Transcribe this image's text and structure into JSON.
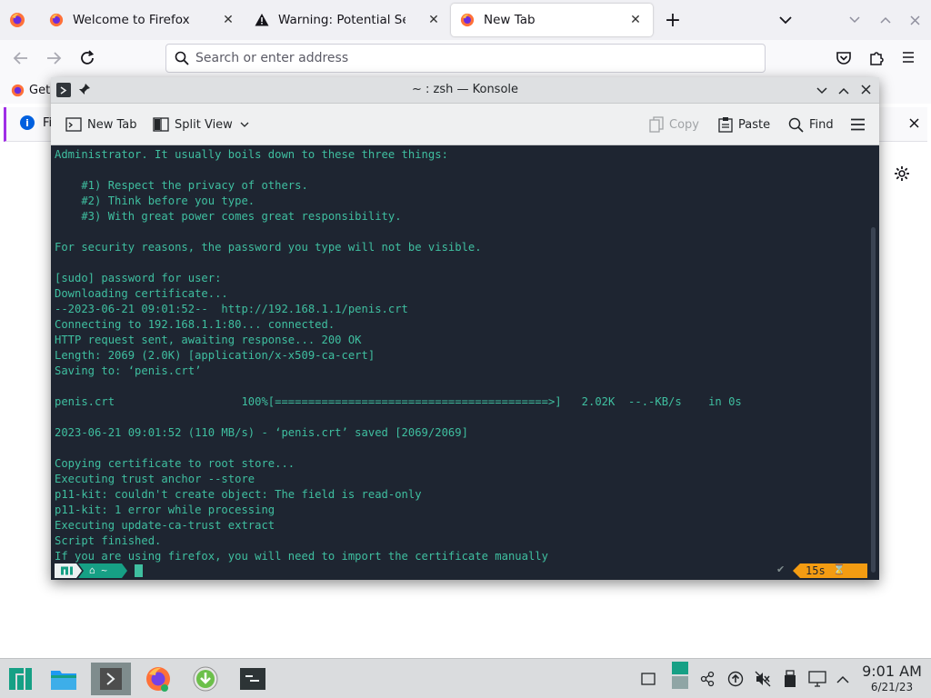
{
  "firefox": {
    "tabs": [
      {
        "title": "Welcome to Firefox",
        "icon": "firefox-icon",
        "active": false
      },
      {
        "title": "Warning: Potential Security Risk Ahead",
        "icon": "warning-icon",
        "active": false
      },
      {
        "title": "New Tab",
        "icon": "firefox-icon",
        "active": true
      }
    ],
    "new_tab_symbol": "+",
    "close_symbol": "✕",
    "url_placeholder": "Search or enter address",
    "bookmark_label": "Get",
    "notification_label": "Fi"
  },
  "konsole": {
    "title": "~ : zsh — Konsole",
    "toolbar": {
      "new_tab": "New Tab",
      "split_view": "Split View",
      "copy": "Copy",
      "paste": "Paste",
      "find": "Find"
    },
    "lines": [
      "Administrator. It usually boils down to these three things:",
      "",
      "    #1) Respect the privacy of others.",
      "    #2) Think before you type.",
      "    #3) With great power comes great responsibility.",
      "",
      "For security reasons, the password you type will not be visible.",
      "",
      "[sudo] password for user:",
      "Downloading certificate...",
      "--2023-06-21 09:01:52--  http://192.168.1.1/penis.crt",
      "Connecting to 192.168.1.1:80... connected.",
      "HTTP request sent, awaiting response... 200 OK",
      "Length: 2069 (2.0K) [application/x-x509-ca-cert]",
      "Saving to: ‘penis.crt’",
      "",
      "penis.crt                   100%[=========================================>]   2.02K  --.-KB/s    in 0s",
      "",
      "2023-06-21 09:01:52 (110 MB/s) - ‘penis.crt’ saved [2069/2069]",
      "",
      "Copying certificate to root store...",
      "Executing trust anchor --store",
      "p11-kit: couldn't create object: The field is read-only",
      "p11-kit: 1 error while processing",
      "Executing update-ca-trust extract",
      "Script finished.",
      "If you are using firefox, you will need to import the certificate manually"
    ],
    "prompt": {
      "home_symbol": "⌂ ~",
      "check_symbol": "✔",
      "duration": "15s",
      "hourglass": "⌛"
    }
  },
  "taskbar": {
    "time": "9:01 AM",
    "date": "6/21/23"
  },
  "colors": {
    "terminal_bg": "#1e2531",
    "terminal_fg": "#3fbfa0",
    "prompt_teal": "#16a085",
    "duration_orange": "#f39c12",
    "firefox_tab_strip": "#f0f0f4"
  }
}
